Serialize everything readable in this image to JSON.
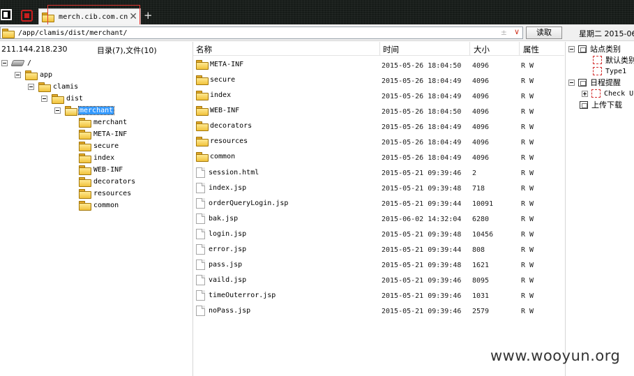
{
  "tab": {
    "title": "merch.cib.com.cn",
    "new_tab": "+"
  },
  "toolbar": {
    "address": "/app/clamis/dist/merchant/",
    "plus_minus": "±",
    "read_button": "读取",
    "date": "星期二 2015-06"
  },
  "left_panel": {
    "ip": "211.144.218.230",
    "summary": "目录(7),文件(10)",
    "tree": [
      {
        "label": "/",
        "depth": 0,
        "kind": "drive",
        "expanded": true
      },
      {
        "label": "app",
        "depth": 1,
        "kind": "folder",
        "expanded": true
      },
      {
        "label": "clamis",
        "depth": 2,
        "kind": "folder",
        "expanded": true
      },
      {
        "label": "dist",
        "depth": 3,
        "kind": "folder",
        "expanded": true
      },
      {
        "label": "merchant",
        "depth": 4,
        "kind": "folder-open",
        "expanded": true,
        "selected": true
      },
      {
        "label": "merchant",
        "depth": 5,
        "kind": "folder"
      },
      {
        "label": "META-INF",
        "depth": 5,
        "kind": "folder"
      },
      {
        "label": "secure",
        "depth": 5,
        "kind": "folder"
      },
      {
        "label": "index",
        "depth": 5,
        "kind": "folder"
      },
      {
        "label": "WEB-INF",
        "depth": 5,
        "kind": "folder"
      },
      {
        "label": "decorators",
        "depth": 5,
        "kind": "folder"
      },
      {
        "label": "resources",
        "depth": 5,
        "kind": "folder"
      },
      {
        "label": "common",
        "depth": 5,
        "kind": "folder"
      }
    ]
  },
  "file_list": {
    "columns": {
      "name": "名称",
      "time": "时间",
      "size": "大小",
      "attr": "属性"
    },
    "rows": [
      {
        "name": "META-INF",
        "type": "folder",
        "time": "2015-05-26 18:04:50",
        "size": "4096",
        "attr": "R W"
      },
      {
        "name": "secure",
        "type": "folder",
        "time": "2015-05-26 18:04:49",
        "size": "4096",
        "attr": "R W"
      },
      {
        "name": "index",
        "type": "folder",
        "time": "2015-05-26 18:04:49",
        "size": "4096",
        "attr": "R W"
      },
      {
        "name": "WEB-INF",
        "type": "folder",
        "time": "2015-05-26 18:04:50",
        "size": "4096",
        "attr": "R W"
      },
      {
        "name": "decorators",
        "type": "folder",
        "time": "2015-05-26 18:04:49",
        "size": "4096",
        "attr": "R W"
      },
      {
        "name": "resources",
        "type": "folder",
        "time": "2015-05-26 18:04:49",
        "size": "4096",
        "attr": "R W"
      },
      {
        "name": "common",
        "type": "folder",
        "time": "2015-05-26 18:04:49",
        "size": "4096",
        "attr": "R W"
      },
      {
        "name": "session.html",
        "type": "file",
        "time": "2015-05-21 09:39:46",
        "size": "2",
        "attr": "R W"
      },
      {
        "name": "index.jsp",
        "type": "file",
        "time": "2015-05-21 09:39:48",
        "size": "718",
        "attr": "R W"
      },
      {
        "name": "orderQueryLogin.jsp",
        "type": "file",
        "time": "2015-05-21 09:39:44",
        "size": "10091",
        "attr": "R W"
      },
      {
        "name": "bak.jsp",
        "type": "file",
        "time": "2015-06-02 14:32:04",
        "size": "6280",
        "attr": "R W"
      },
      {
        "name": "login.jsp",
        "type": "file",
        "time": "2015-05-21 09:39:48",
        "size": "10456",
        "attr": "R W"
      },
      {
        "name": "error.jsp",
        "type": "file",
        "time": "2015-05-21 09:39:44",
        "size": "808",
        "attr": "R W"
      },
      {
        "name": "pass.jsp",
        "type": "file",
        "time": "2015-05-21 09:39:48",
        "size": "1621",
        "attr": "R W"
      },
      {
        "name": "vaild.jsp",
        "type": "file",
        "time": "2015-05-21 09:39:46",
        "size": "8095",
        "attr": "R W"
      },
      {
        "name": "timeOuterror.jsp",
        "type": "file",
        "time": "2015-05-21 09:39:46",
        "size": "1031",
        "attr": "R W"
      },
      {
        "name": "noPass.jsp",
        "type": "file",
        "time": "2015-05-21 09:39:46",
        "size": "2579",
        "attr": "R W"
      }
    ]
  },
  "right_panel": {
    "site_category": "站点类别",
    "default_category": "默认类别",
    "type1": "Type1",
    "schedule": "日程提醒",
    "check": "Check U",
    "upload_download": "上传下载"
  },
  "watermark": "www.wooyun.org",
  "colors": {
    "selection": "#3399ff",
    "highlight_border": "#e53935",
    "folder": "#f1c33c"
  }
}
